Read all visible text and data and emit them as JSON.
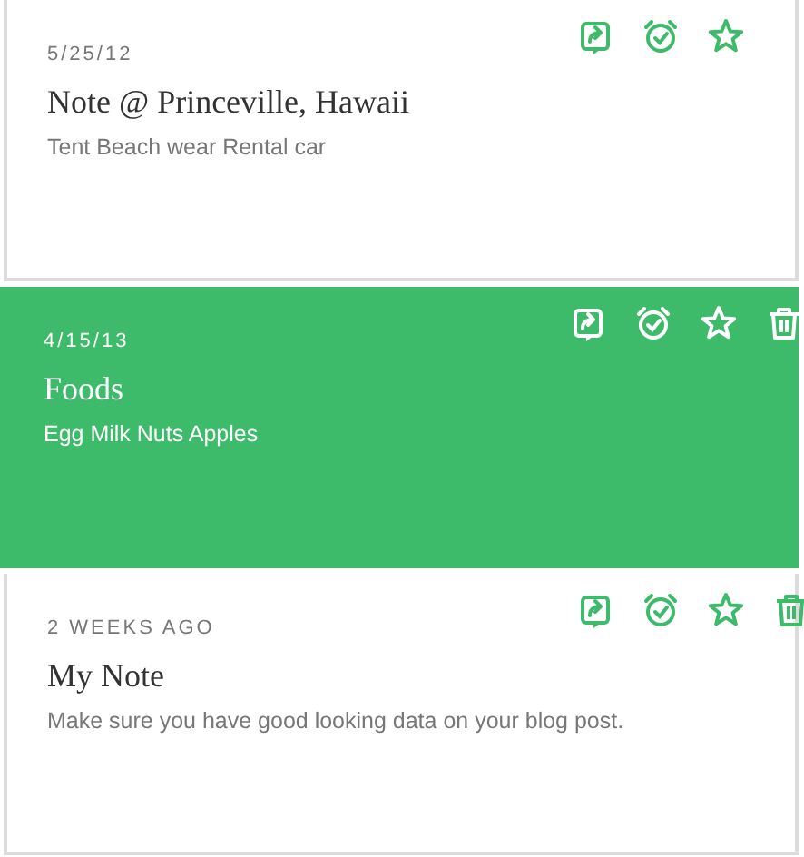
{
  "notes": [
    {
      "date": "5/25/12",
      "title": "Note @ Princeville, Hawaii",
      "snippet": "Tent Beach wear Rental car",
      "selected": false,
      "trash_visible": false
    },
    {
      "date": "4/15/13",
      "title": "Foods",
      "snippet": "Egg Milk Nuts Apples",
      "selected": true,
      "trash_visible": true
    },
    {
      "date": "2 WEEKS AGO",
      "title": "My Note",
      "snippet": "Make sure you have good looking data on your blog post.",
      "selected": false,
      "trash_visible": true
    }
  ]
}
